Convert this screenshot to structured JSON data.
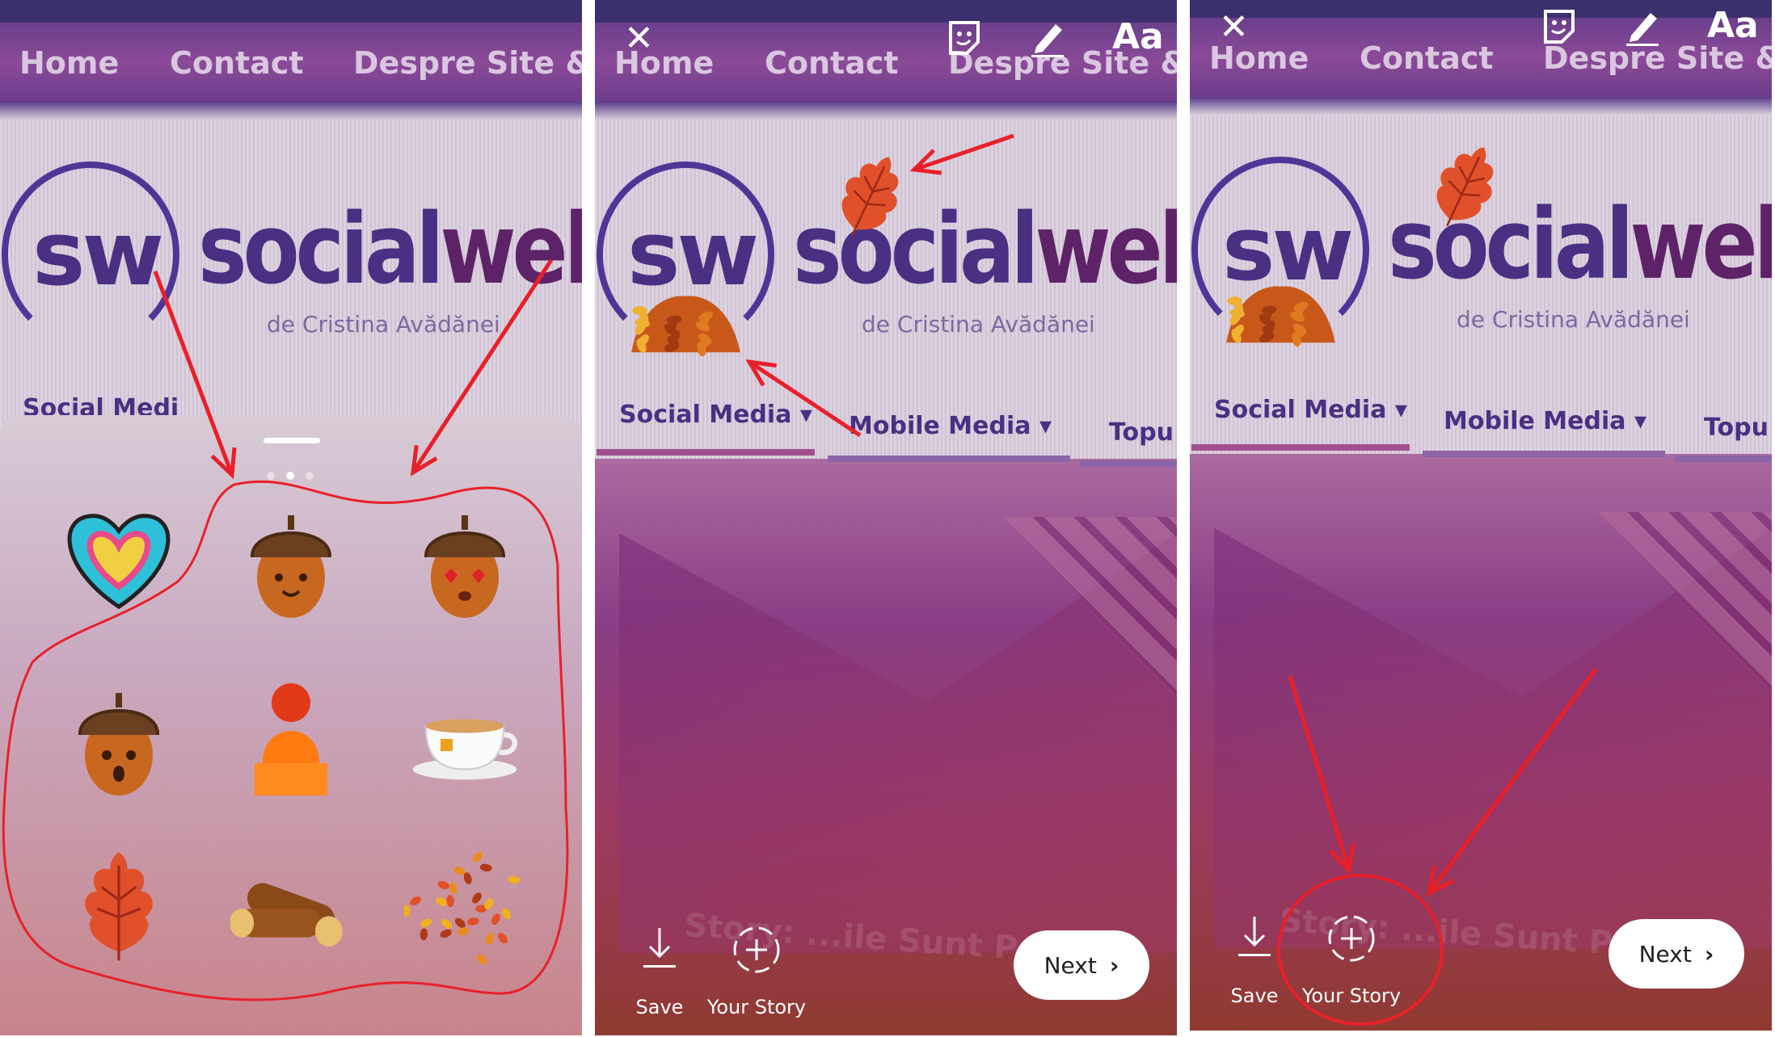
{
  "website": {
    "nav": [
      "Home",
      "Contact",
      "Despre Site & Ec"
    ],
    "logo_mark": "sw",
    "logo_text_a": "social",
    "logo_text_b": "web",
    "tagline": "de Cristina Avădănei",
    "subnav": [
      "Social Media",
      "Mobile Media",
      "Topu"
    ],
    "subnav_first_partial": "Social Medi",
    "watermark": "Story: ...ile Sunt Pe M"
  },
  "sticker_tray": {
    "page_index": 2,
    "page_count": 3,
    "stickers": [
      "heart-sticker",
      "acorn-smile-sticker",
      "acorn-heart-eyes-sticker",
      "acorn-surprised-sticker",
      "knit-hat-sticker",
      "teacup-sticker",
      "oak-leaf-sticker",
      "logs-sticker",
      "scattered-leaves-sticker"
    ]
  },
  "editor": {
    "close_icon": "close-icon",
    "sticker_icon": "sticker-icon",
    "draw_icon": "pen-icon",
    "text_button": "Aa",
    "save_label": "Save",
    "your_story_label": "Your Story",
    "next_label": "Next"
  },
  "annotation_color": "#e8202a"
}
